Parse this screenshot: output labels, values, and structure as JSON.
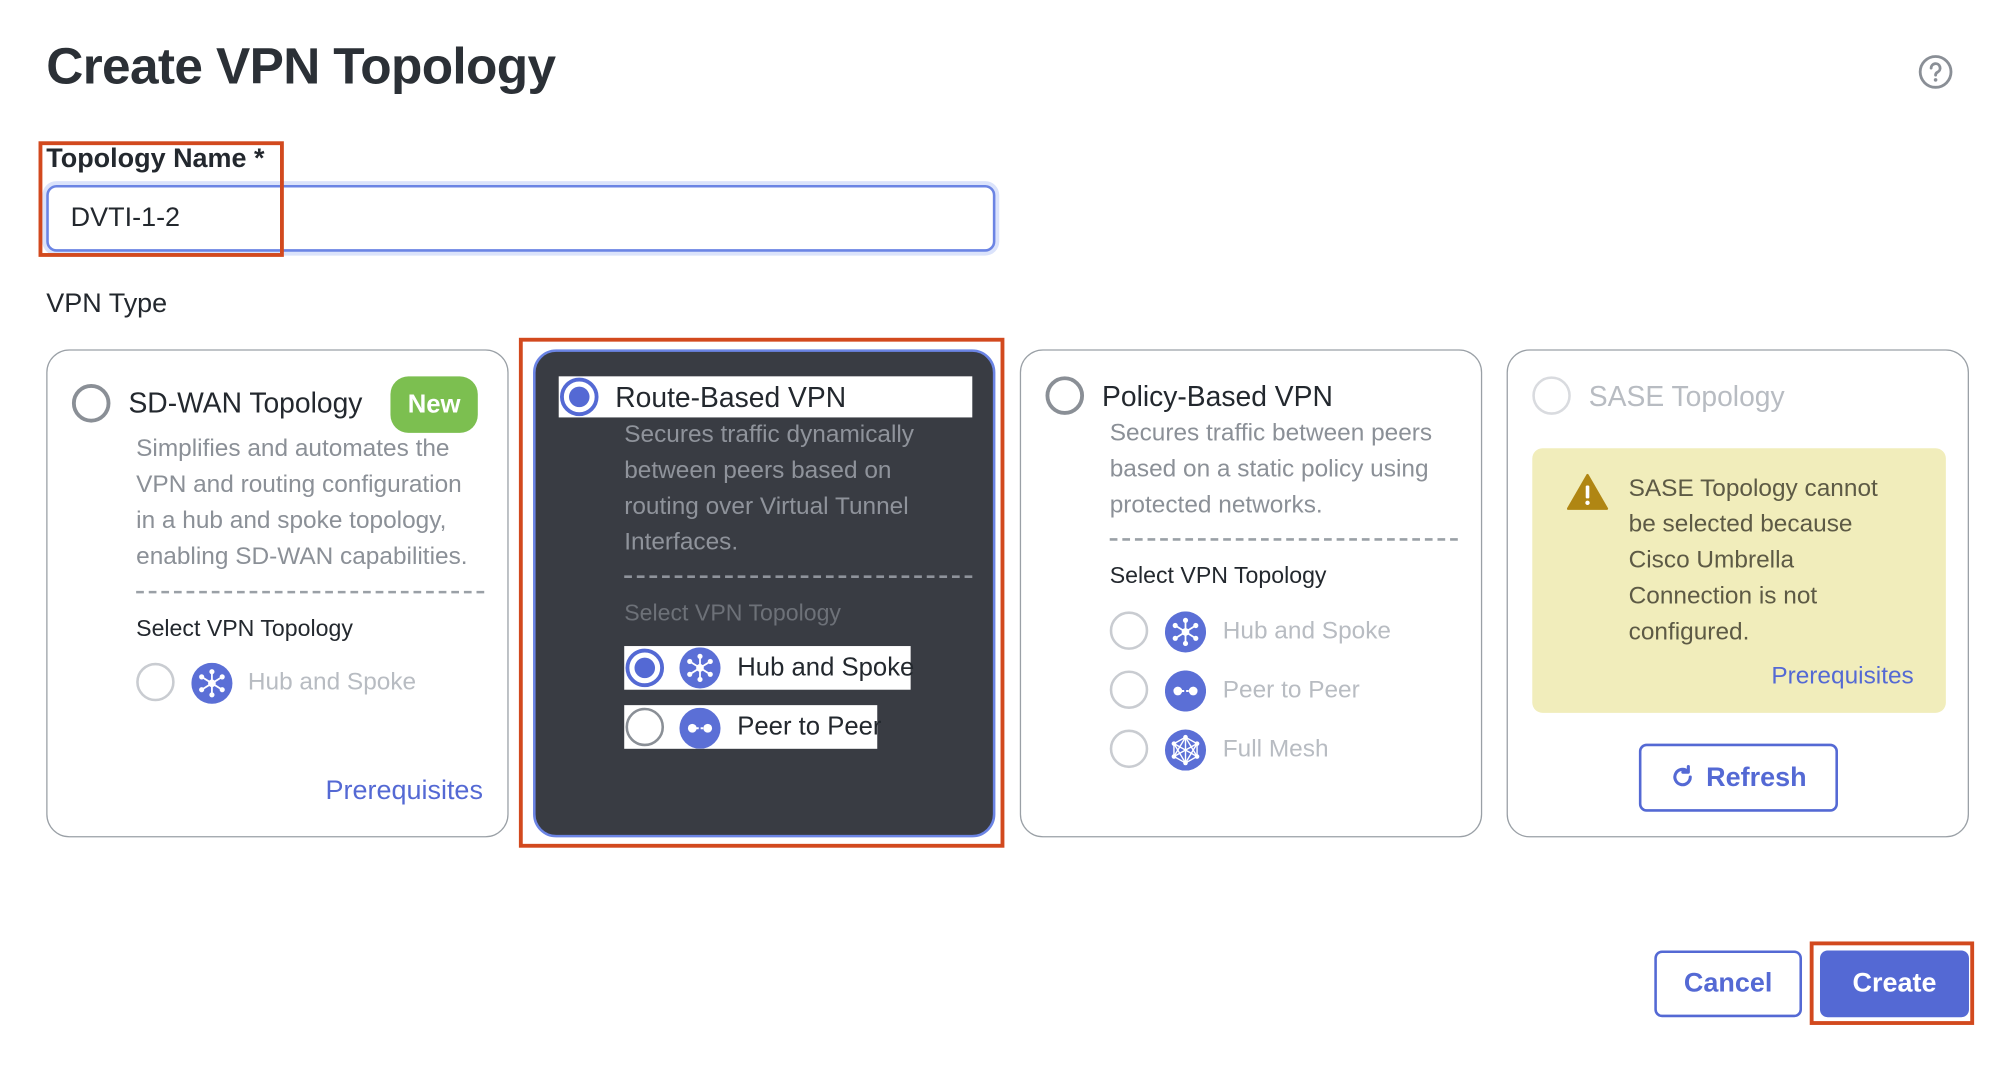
{
  "dialog": {
    "title": "Create VPN Topology",
    "help_icon": "question-circle-icon"
  },
  "topology_name": {
    "label": "Topology Name *",
    "value": "DVTI-1-2"
  },
  "vpn_type": {
    "label": "VPN Type",
    "options": [
      {
        "title": "SD-WAN Topology",
        "badge": "New",
        "selected": false,
        "description": [
          "Simplifies and automates the",
          "VPN and routing configuration",
          "in a hub and spoke topology,",
          "enabling SD-WAN capabilities."
        ],
        "topology_label": "Select VPN Topology",
        "topologies": [
          {
            "label": "Hub and Spoke",
            "icon": "hub-and-spoke-icon",
            "selected": false,
            "enabled": false
          }
        ],
        "link": "Prerequisites"
      },
      {
        "title": "Route-Based VPN",
        "selected": true,
        "description": [
          "Secures traffic dynamically",
          "between peers based on",
          "routing over Virtual Tunnel",
          "Interfaces."
        ],
        "topology_label": "Select VPN Topology",
        "topologies": [
          {
            "label": "Hub and Spoke",
            "icon": "hub-and-spoke-icon",
            "selected": true,
            "enabled": true
          },
          {
            "label": "Peer to Peer",
            "icon": "peer-to-peer-icon",
            "selected": false,
            "enabled": true
          }
        ]
      },
      {
        "title": "Policy-Based VPN",
        "selected": false,
        "description": [
          "Secures traffic between peers",
          "based on a static policy using",
          "protected networks."
        ],
        "topology_label": "Select VPN Topology",
        "topologies": [
          {
            "label": "Hub and Spoke",
            "icon": "hub-and-spoke-icon",
            "selected": false,
            "enabled": false
          },
          {
            "label": "Peer to Peer",
            "icon": "peer-to-peer-icon",
            "selected": false,
            "enabled": false
          },
          {
            "label": "Full Mesh",
            "icon": "full-mesh-icon",
            "selected": false,
            "enabled": false
          }
        ]
      },
      {
        "title": "SASE Topology",
        "selected": false,
        "enabled": false,
        "warning": [
          "SASE Topology cannot",
          "be selected because",
          "Cisco Umbrella",
          "Connection is not",
          "configured."
        ],
        "warning_icon": "warning-triangle-icon",
        "link": "Prerequisites",
        "refresh_label": "Refresh",
        "refresh_icon": "refresh-icon"
      }
    ]
  },
  "footer": {
    "cancel_label": "Cancel",
    "create_label": "Create"
  },
  "colors": {
    "accent": "#5469d4",
    "annotation": "#d2491e",
    "badge_green": "#7cbf50",
    "selected_card": "#393c43",
    "warning_bg": "#f1edbb"
  }
}
